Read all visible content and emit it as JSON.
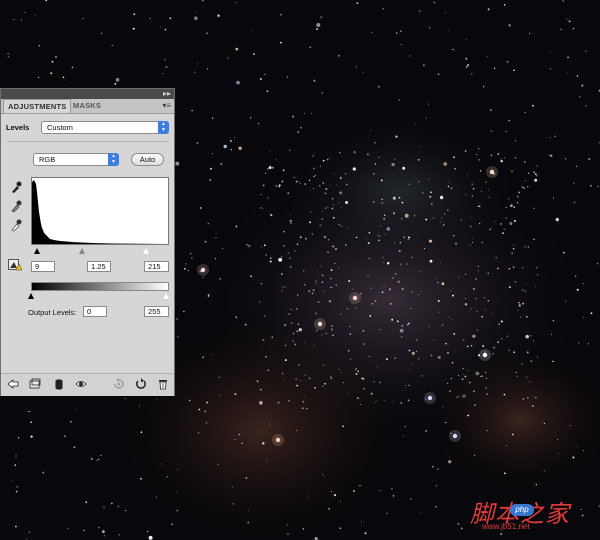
{
  "panel": {
    "tabs": [
      {
        "label": "ADJUSTMENTS"
      },
      {
        "label": "MASKS"
      }
    ],
    "collapse_icon": "double-chevron-right-icon",
    "menu_icon": "panel-menu-icon",
    "preset_label": "Levels",
    "preset_value": "Custom",
    "channel_value": "RGB",
    "auto_label": "Auto",
    "input_levels": {
      "black": "9",
      "gamma": "1.25",
      "white": "215"
    },
    "output_label": "Output Levels:",
    "output_levels": {
      "black": "0",
      "white": "255"
    },
    "footer_icons": [
      "back-arrow-icon",
      "clip-layer-icon",
      "mask-icon",
      "eye-icon",
      "previous-state-icon",
      "reset-icon",
      "trash-icon"
    ]
  },
  "watermark": {
    "text": "脚本之家",
    "badge": "php",
    "url": "www.jb51.net"
  },
  "colors": {
    "panel_bg": "#d6d6d6",
    "accent": "#3d7de0",
    "watermark": "#e43a3a"
  }
}
